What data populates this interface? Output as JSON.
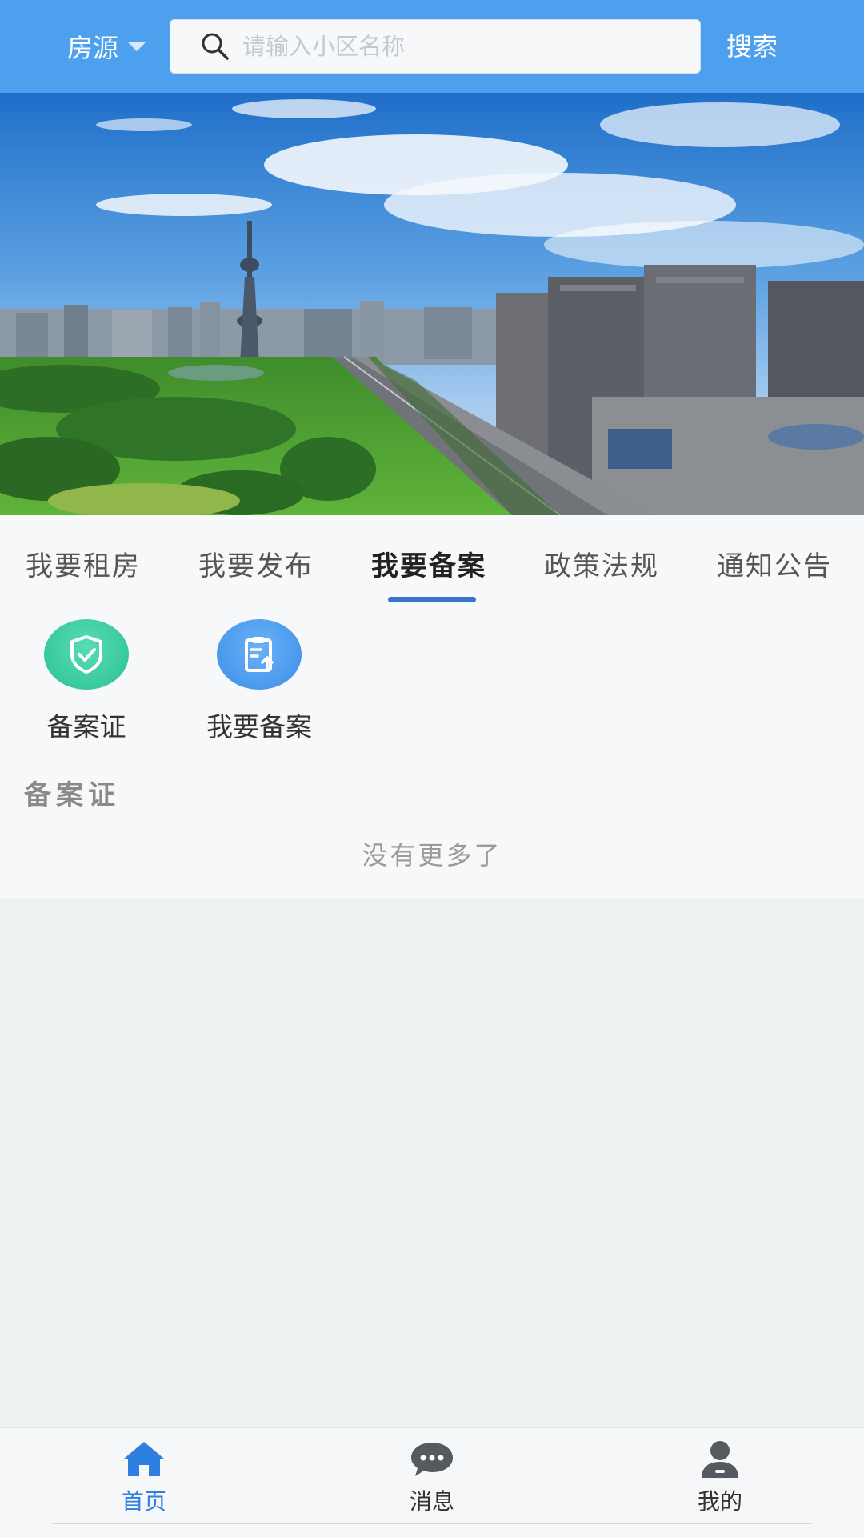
{
  "header": {
    "city_label": "房源",
    "search_placeholder": "请输入小区名称",
    "search_button": "搜索"
  },
  "tabs": [
    {
      "label": "我要租房",
      "active": false
    },
    {
      "label": "我要发布",
      "active": false
    },
    {
      "label": "我要备案",
      "active": true
    },
    {
      "label": "政策法规",
      "active": false
    },
    {
      "label": "通知公告",
      "active": false
    }
  ],
  "tiles": [
    {
      "label": "备案证",
      "icon": "shield-check-icon",
      "color": "#33c79b"
    },
    {
      "label": "我要备案",
      "icon": "clipboard-upload-icon",
      "color": "#4a9cf0"
    }
  ],
  "section": {
    "title": "备案证",
    "empty_text": "没有更多了"
  },
  "bottom_nav": [
    {
      "label": "首页",
      "icon": "home-icon",
      "active": true
    },
    {
      "label": "消息",
      "icon": "chat-bubble-icon",
      "active": false
    },
    {
      "label": "我的",
      "icon": "user-icon",
      "active": false
    }
  ],
  "colors": {
    "header_bg": "#4da0ee",
    "active_tab_indicator": "#3a72c8",
    "nav_active": "#2f7fe0"
  }
}
